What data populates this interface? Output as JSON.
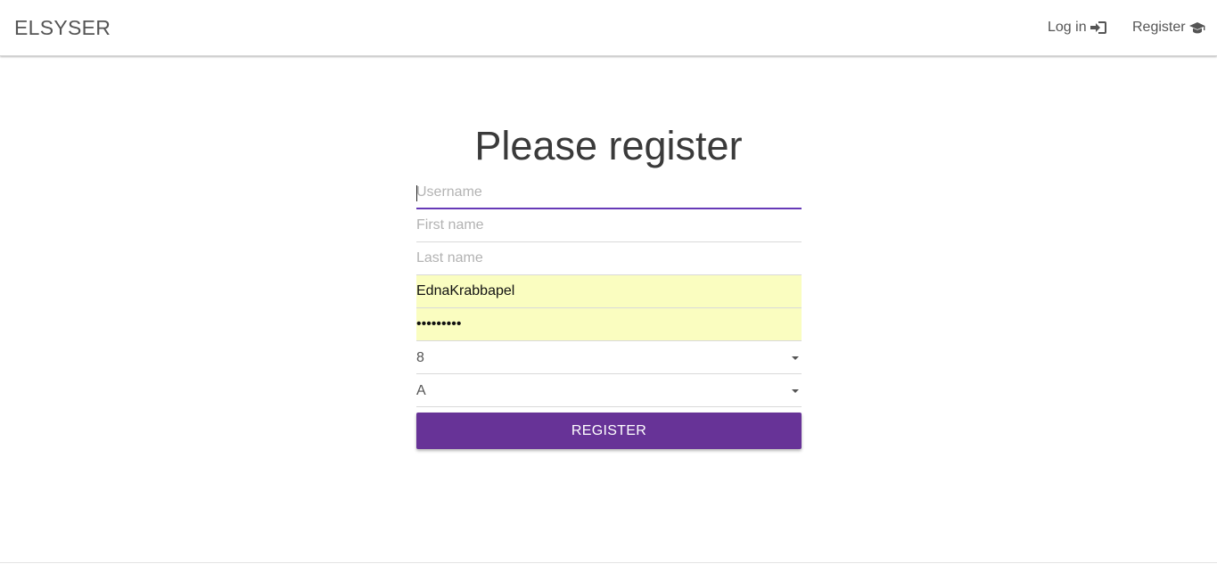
{
  "navbar": {
    "brand": "ELSYSER",
    "login_label": "Log in",
    "login_icon": "sign-in-icon",
    "register_label": "Register",
    "register_icon": "graduation-cap-icon"
  },
  "page": {
    "title": "Please register"
  },
  "form": {
    "username": {
      "placeholder": "Username",
      "value": ""
    },
    "first_name": {
      "placeholder": "First name",
      "value": ""
    },
    "last_name": {
      "placeholder": "Last name",
      "value": ""
    },
    "email": {
      "value": "EdnaKrabbapel"
    },
    "password": {
      "value": "•••••••••"
    },
    "grade": {
      "selected": "8"
    },
    "class_letter": {
      "selected": "A"
    },
    "submit_label": "REGISTER"
  },
  "colors": {
    "accent": "#673ab7",
    "button": "#673397",
    "autofill": "#fafdc0"
  }
}
